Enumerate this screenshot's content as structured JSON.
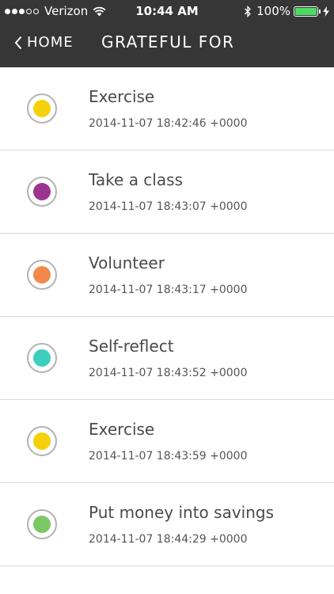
{
  "status_bar": {
    "carrier": "Verizon",
    "time": "10:44 AM",
    "battery_percent": "100%",
    "battery_level": 1.0,
    "signal_bars_filled": 3,
    "signal_bars_total": 5,
    "battery_color": "#4cd964"
  },
  "nav": {
    "back_label": "HOME",
    "title": "GRATEFUL FOR",
    "background_color": "#363636"
  },
  "items": [
    {
      "title": "Exercise",
      "timestamp": "2014-11-07 18:42:46 +0000",
      "color": "#f5d10b"
    },
    {
      "title": "Take a class",
      "timestamp": "2014-11-07 18:43:07 +0000",
      "color": "#9c3590"
    },
    {
      "title": "Volunteer",
      "timestamp": "2014-11-07 18:43:17 +0000",
      "color": "#f2894a"
    },
    {
      "title": "Self-reflect",
      "timestamp": "2014-11-07 18:43:52 +0000",
      "color": "#3ccfbe"
    },
    {
      "title": "Exercise",
      "timestamp": "2014-11-07 18:43:59 +0000",
      "color": "#f5d10b"
    },
    {
      "title": "Put money into savings",
      "timestamp": "2014-11-07 18:44:29 +0000",
      "color": "#7cc866"
    }
  ]
}
